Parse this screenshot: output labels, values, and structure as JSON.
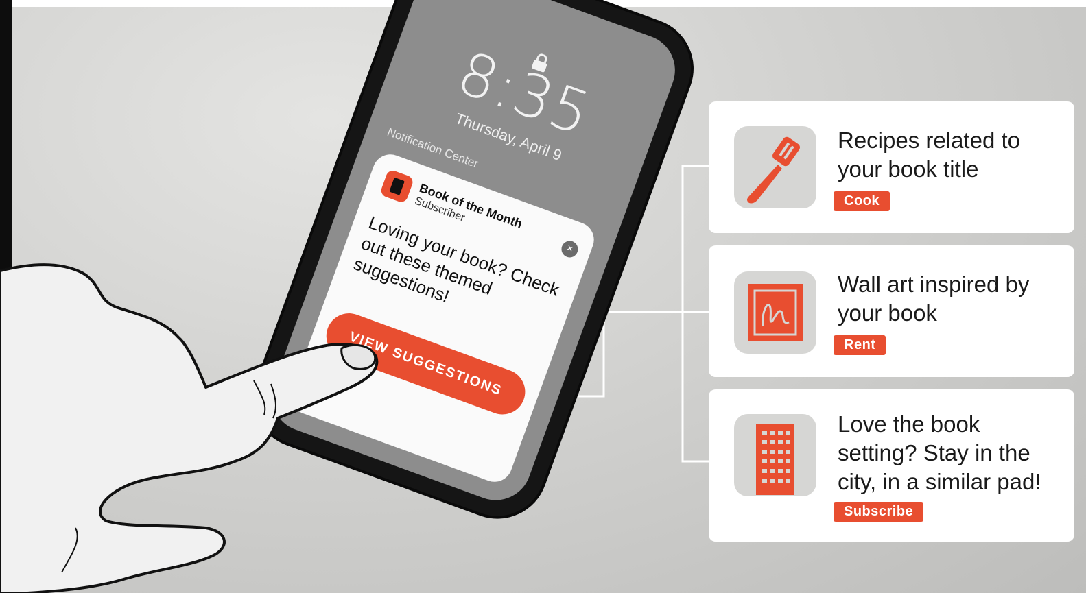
{
  "phone": {
    "time": "8:35",
    "date": "Thursday, April 9",
    "notification_center": "Notification Center",
    "notification": {
      "app_name": "Book of the Month",
      "app_subtitle": "Subscriber",
      "message": "Loving your book? Check out these themed suggestions!",
      "button_label": "VIEW SUGGESTIONS",
      "close_glyph": "×"
    }
  },
  "suggestions": [
    {
      "title": "Recipes related to your book title",
      "tag": "Cook",
      "icon": "spatula-icon"
    },
    {
      "title": "Wall art inspired by your book",
      "tag": "Rent",
      "icon": "wall-art-icon"
    },
    {
      "title": "Love the book setting? Stay in the city, in a similar pad!",
      "tag": "Subscribe",
      "icon": "building-icon"
    }
  ],
  "colors": {
    "accent": "#e84e30",
    "card": "#ffffff",
    "tile": "#d6d6d4"
  }
}
